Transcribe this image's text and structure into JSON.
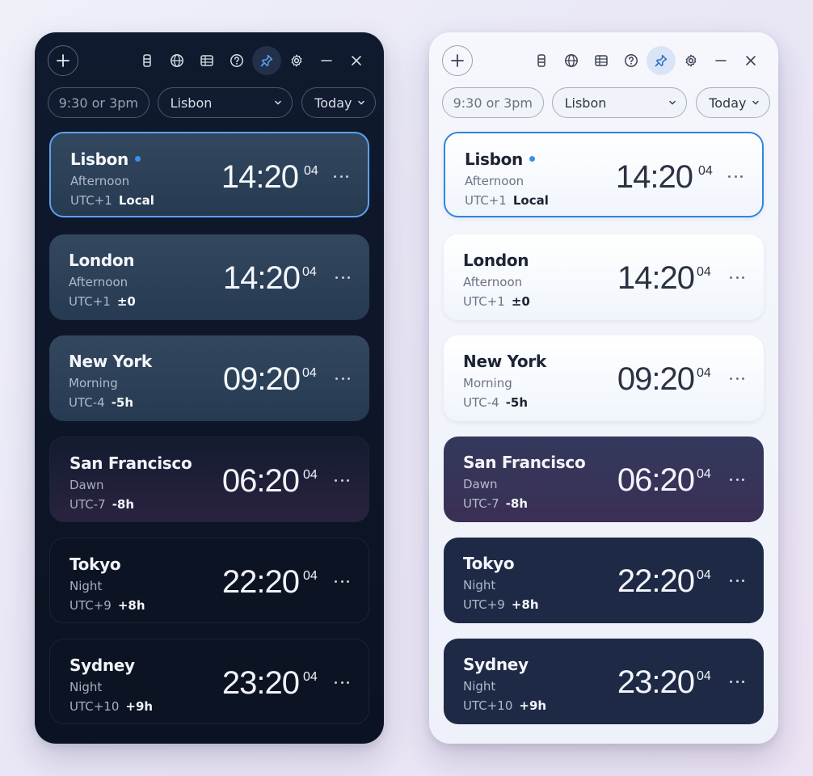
{
  "panels": [
    {
      "theme": "dark",
      "filters": {
        "time_placeholder": "9:30 or 3pm",
        "city": "Lisbon",
        "day": "Today"
      },
      "cards": [
        {
          "city": "Lisbon",
          "period": "Afternoon",
          "utc": "UTC+1",
          "diff": "Local",
          "time": "14:20",
          "seconds": "04",
          "selected": true,
          "variant": "day"
        },
        {
          "city": "London",
          "period": "Afternoon",
          "utc": "UTC+1",
          "diff": "±0",
          "time": "14:20",
          "seconds": "04",
          "variant": "day"
        },
        {
          "city": "New York",
          "period": "Morning",
          "utc": "UTC-4",
          "diff": "-5h",
          "time": "09:20",
          "seconds": "04",
          "variant": "day"
        },
        {
          "city": "San Francisco",
          "period": "Dawn",
          "utc": "UTC-7",
          "diff": "-8h",
          "time": "06:20",
          "seconds": "04",
          "variant": "dawn"
        },
        {
          "city": "Tokyo",
          "period": "Night",
          "utc": "UTC+9",
          "diff": "+8h",
          "time": "22:20",
          "seconds": "04",
          "variant": "night"
        },
        {
          "city": "Sydney",
          "period": "Night",
          "utc": "UTC+10",
          "diff": "+9h",
          "time": "23:20",
          "seconds": "04",
          "variant": "night"
        }
      ]
    },
    {
      "theme": "light",
      "filters": {
        "time_placeholder": "9:30 or 3pm",
        "city": "Lisbon",
        "day": "Today"
      },
      "cards": [
        {
          "city": "Lisbon",
          "period": "Afternoon",
          "utc": "UTC+1",
          "diff": "Local",
          "time": "14:20",
          "seconds": "04",
          "selected": true,
          "variant": "day"
        },
        {
          "city": "London",
          "period": "Afternoon",
          "utc": "UTC+1",
          "diff": "±0",
          "time": "14:20",
          "seconds": "04",
          "variant": "day"
        },
        {
          "city": "New York",
          "period": "Morning",
          "utc": "UTC-4",
          "diff": "-5h",
          "time": "09:20",
          "seconds": "04",
          "variant": "day"
        },
        {
          "city": "San Francisco",
          "period": "Dawn",
          "utc": "UTC-7",
          "diff": "-8h",
          "time": "06:20",
          "seconds": "04",
          "variant": "dawn"
        },
        {
          "city": "Tokyo",
          "period": "Night",
          "utc": "UTC+9",
          "diff": "+8h",
          "time": "22:20",
          "seconds": "04",
          "variant": "night"
        },
        {
          "city": "Sydney",
          "period": "Night",
          "utc": "UTC+10",
          "diff": "+9h",
          "time": "23:20",
          "seconds": "04",
          "variant": "night"
        }
      ]
    }
  ],
  "toolbar_icons": [
    "add-icon",
    "list-icon",
    "globe-icon",
    "table-icon",
    "help-icon",
    "pin-icon",
    "gear-icon",
    "minimize-icon",
    "close-icon"
  ],
  "colors": {
    "accent_dark": "#5aa2ee",
    "accent_light": "#2e86de",
    "local_dot": "#3b8ff0"
  }
}
